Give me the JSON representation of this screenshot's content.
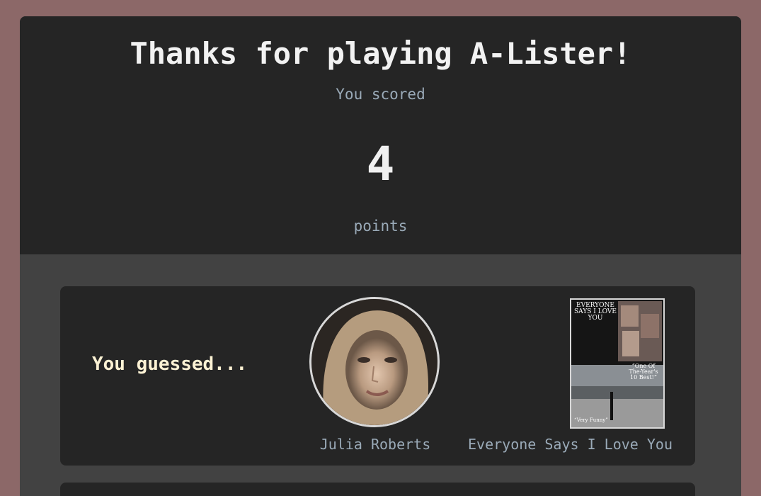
{
  "header": {
    "title": "Thanks for playing A-Lister!",
    "subtitle": "You scored",
    "score": "4",
    "points_label": "points"
  },
  "guess": {
    "label": "You guessed...",
    "actor_name": "Julia Roberts",
    "movie_title": "Everyone Says I Love You",
    "poster_title": "EVERYONE SAYS I LOVE YOU",
    "poster_quote": "“One Of The-Year's 10 Best!”",
    "poster_tagline": "“Very Funny”"
  },
  "colors": {
    "background": "#8c6868",
    "panel": "#424242",
    "header": "#252525",
    "card": "#252525",
    "accent_text": "#9aaab8",
    "guess_text": "#fcf2d4"
  }
}
